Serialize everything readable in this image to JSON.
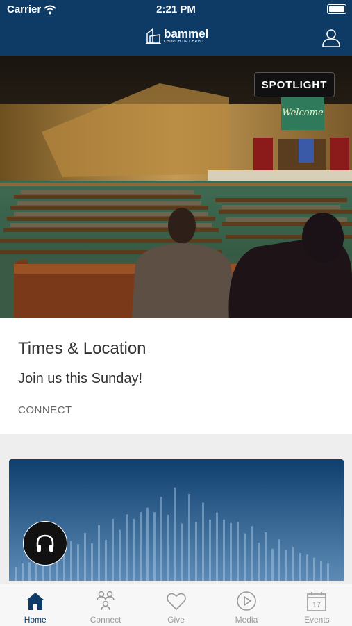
{
  "status": {
    "carrier": "Carrier",
    "time": "2:21 PM"
  },
  "header": {
    "logo_name": "bammel",
    "logo_sub": "CHURCH OF CHRIST"
  },
  "hero": {
    "badge": "SPOTLIGHT",
    "screen_text": "Welcome"
  },
  "card": {
    "title": "Times & Location",
    "subtitle": "Join us this Sunday!",
    "link": "CONNECT"
  },
  "tabs": [
    {
      "label": "Home",
      "icon": "home-icon",
      "active": true
    },
    {
      "label": "Connect",
      "icon": "people-icon",
      "active": false
    },
    {
      "label": "Give",
      "icon": "heart-icon",
      "active": false
    },
    {
      "label": "Media",
      "icon": "play-icon",
      "active": false
    },
    {
      "label": "Events",
      "icon": "calendar-icon",
      "active": false
    }
  ],
  "events_icon_day": "17",
  "colors": {
    "brand": "#0d3b66",
    "inactive": "#999999"
  }
}
